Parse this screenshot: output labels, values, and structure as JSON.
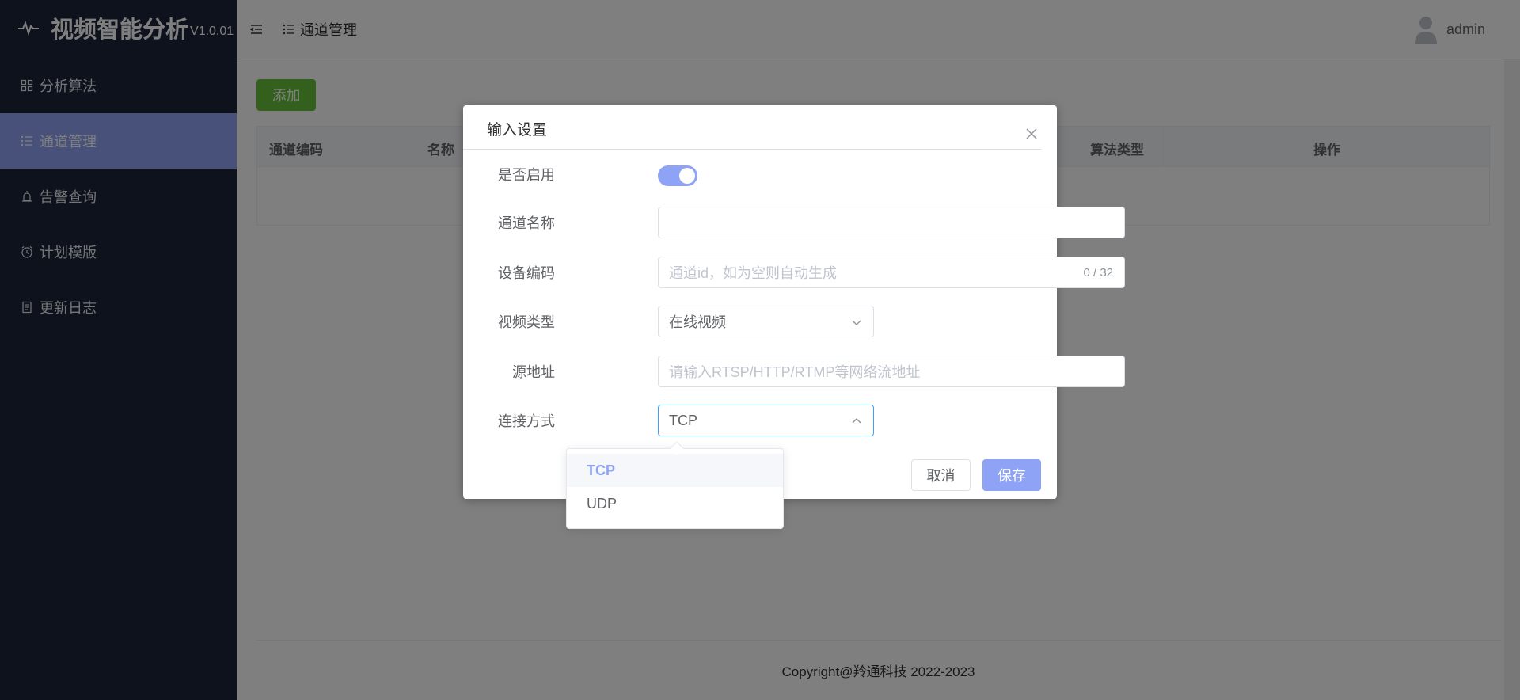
{
  "app": {
    "name": "视频智能分析",
    "version": "V1.0.01"
  },
  "sidebar": {
    "items": [
      {
        "label": "分析算法",
        "icon": "grid-icon"
      },
      {
        "label": "通道管理",
        "icon": "list-icon",
        "active": true
      },
      {
        "label": "告警查询",
        "icon": "alarm-icon"
      },
      {
        "label": "计划模版",
        "icon": "clock-icon"
      },
      {
        "label": "更新日志",
        "icon": "document-icon"
      }
    ]
  },
  "header": {
    "breadcrumb": "通道管理",
    "user": "admin"
  },
  "main": {
    "add_label": "添加",
    "table": {
      "columns": [
        "通道编码",
        "名称",
        "算法类型",
        "操作"
      ]
    },
    "footer": "Copyright@羚通科技 2022-2023"
  },
  "dialog": {
    "title": "输入设置",
    "fields": {
      "enabled": {
        "label": "是否启用",
        "value": true
      },
      "channel_name": {
        "label": "通道名称",
        "value": ""
      },
      "device_code": {
        "label": "设备编码",
        "placeholder": "通道id，如为空则自动生成",
        "counter": "0 / 32"
      },
      "video_type": {
        "label": "视频类型",
        "value": "在线视频"
      },
      "source": {
        "label": "源地址",
        "placeholder": "请输入RTSP/HTTP/RTMP等网络流地址"
      },
      "connection": {
        "label": "连接方式",
        "value": "TCP"
      }
    },
    "cancel_label": "取消",
    "save_label": "保存"
  },
  "dropdown": {
    "options": [
      "TCP",
      "UDP"
    ],
    "selected": "TCP"
  },
  "colors": {
    "sidebar_bg": "#1d2538",
    "accent": "#8ea3f5",
    "add_button": "#67c23a"
  }
}
